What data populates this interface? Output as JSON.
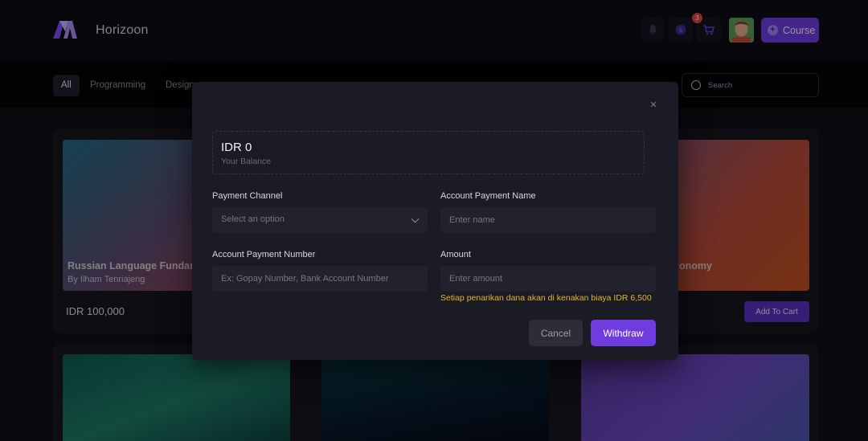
{
  "header": {
    "app_title": "Horizoon",
    "cart_badge": "3",
    "course_button": "Course",
    "icons": [
      "bell-icon",
      "coin-icon",
      "cart-icon"
    ]
  },
  "nav": {
    "tabs": [
      {
        "label": "All",
        "active": true
      },
      {
        "label": "Programming",
        "active": false
      },
      {
        "label": "Design",
        "active": false
      }
    ],
    "search_placeholder": "Search"
  },
  "cards": [
    {
      "title": "Russian Language Fundam",
      "author": "By Ilham Tenriajeng",
      "price": "IDR 100,000"
    },
    {
      "title": "onomy",
      "button": "Add To Cart"
    }
  ],
  "modal": {
    "balance_amount": "IDR 0",
    "balance_label": "Your Balance",
    "payment_channel_label": "Payment Channel",
    "payment_channel_value": "Select an option",
    "account_name_label": "Account Payment Name",
    "account_name_placeholder": "Enter name",
    "account_number_label": "Account Payment Number",
    "account_number_placeholder": "Ex: Gopay Number, Bank Account Number",
    "amount_label": "Amount",
    "amount_placeholder": "Enter amount",
    "fee_note": "Setiap penarikan dana akan di kenakan biaya IDR 6,500",
    "cancel_label": "Cancel",
    "withdraw_label": "Withdraw"
  },
  "colors": {
    "accent": "#6f3ce0",
    "warning": "#e3b62a",
    "badge": "#e0453a"
  }
}
